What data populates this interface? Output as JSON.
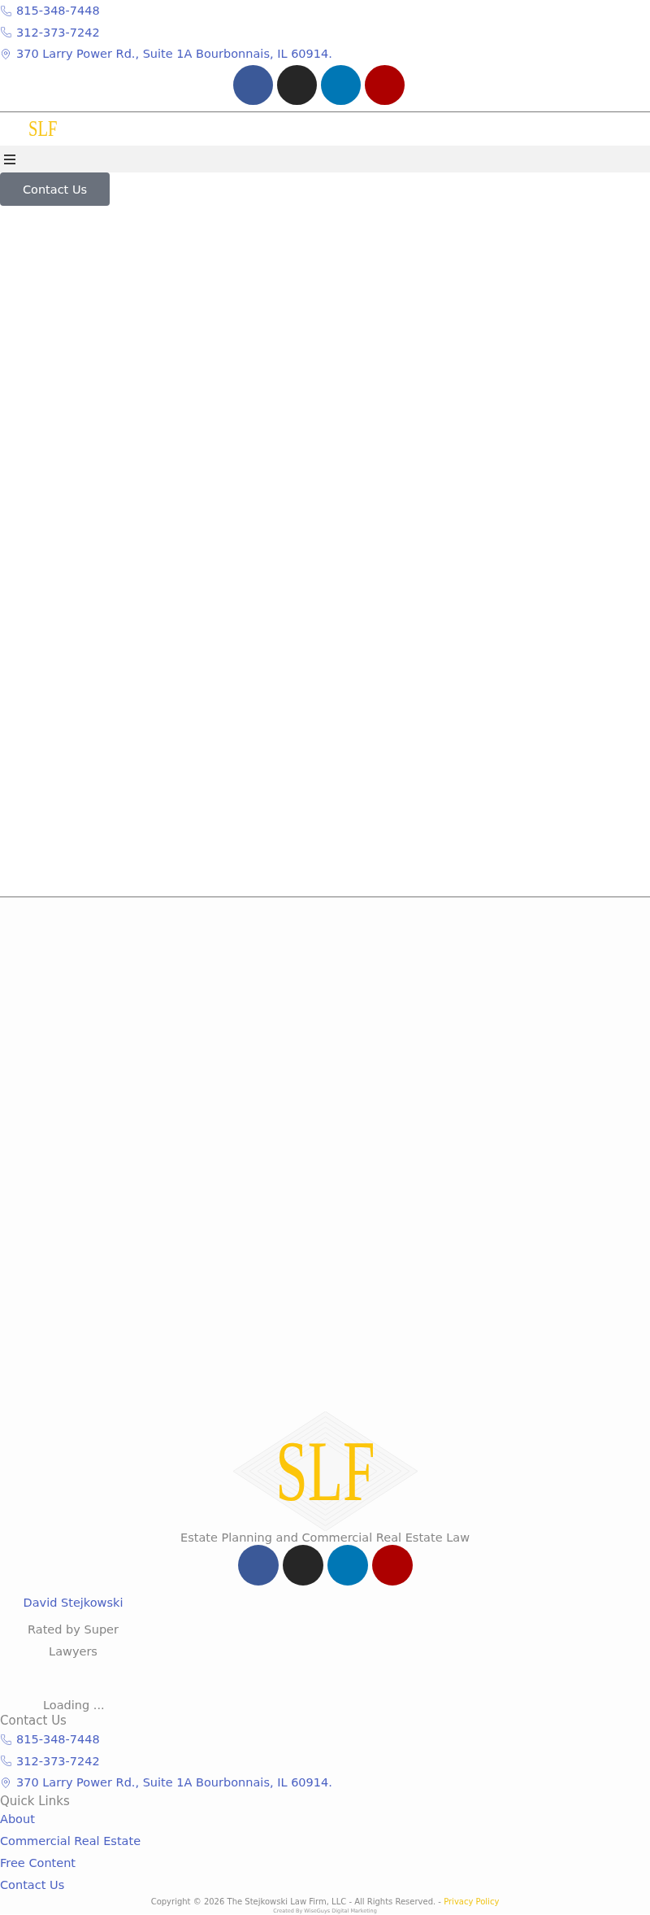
{
  "header": {
    "contacts": [
      {
        "kind": "phone",
        "text": "815-348-7448"
      },
      {
        "kind": "phone",
        "text": "312-373-7242"
      },
      {
        "kind": "address",
        "text": "370 Larry Power Rd., Suite 1A Bourbonnais, IL 60914."
      }
    ],
    "social_links": [
      {
        "color": "#3b5998"
      },
      {
        "color": "#262626"
      },
      {
        "color": "#0077b5"
      },
      {
        "color": "#ad0000"
      }
    ],
    "logo": "SLF",
    "contact_button": "Contact Us"
  },
  "footer": {
    "logo": "SLF",
    "tagline": "Estate Planning and Commercial Real Estate Law",
    "social_links": [
      {
        "color": "#3b5998"
      },
      {
        "color": "#262626"
      },
      {
        "color": "#0077b5"
      },
      {
        "color": "#ad0000"
      }
    ],
    "badge": {
      "name": "David Stejkowski",
      "caption": "Rated by Super Lawyers"
    },
    "loading": "Loading ...",
    "contact": {
      "heading": "Contact Us",
      "items": [
        {
          "kind": "phone",
          "text": "815-348-7448"
        },
        {
          "kind": "phone",
          "text": "312-373-7242"
        },
        {
          "kind": "address",
          "text": "370 Larry Power Rd., Suite 1A Bourbonnais, IL 60914."
        }
      ]
    },
    "quick_links": {
      "heading": "Quick Links",
      "links": [
        "About",
        "Commercial Real Estate",
        "Free Content",
        "Contact Us"
      ]
    },
    "copyright": "Copyright © 2026 The Stejkowski Law Firm, LLC - All Rights Reserved. - ",
    "privacy_link": "Privacy Policy",
    "credit": "Created By WiseGuys Digital Marketing"
  }
}
